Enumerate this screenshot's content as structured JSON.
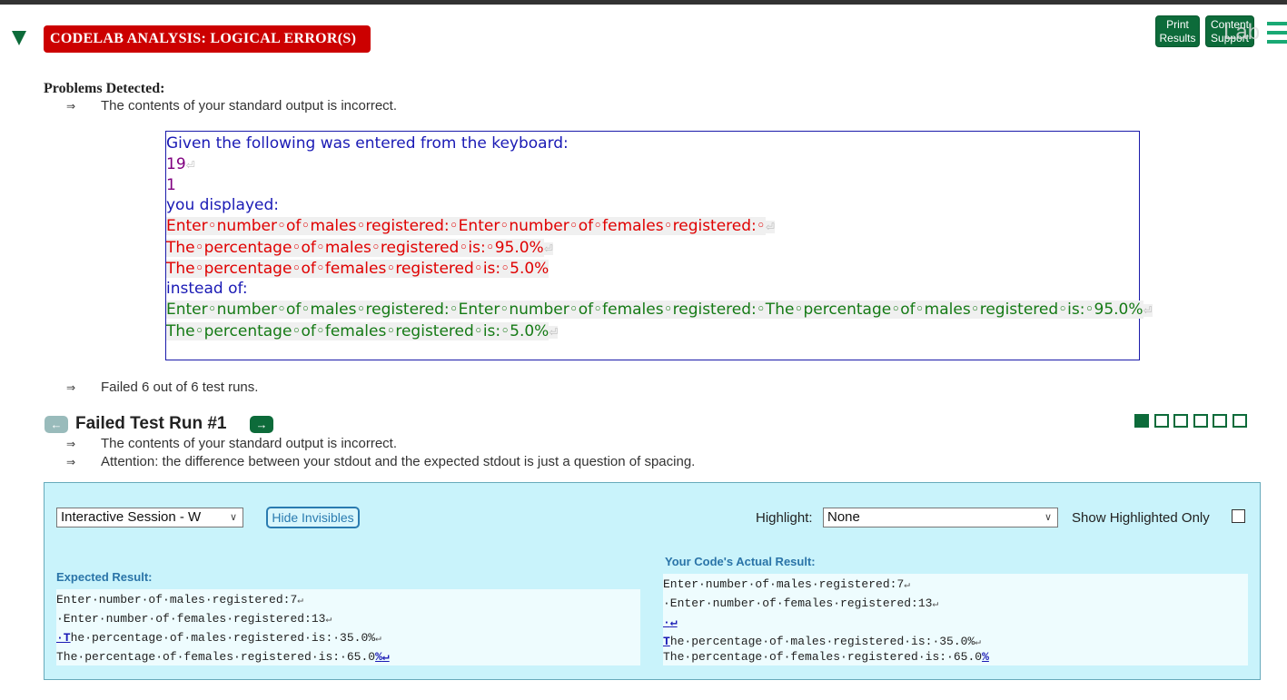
{
  "banner": {
    "title": "CODELAB ANALYSIS: LOGICAL ERROR(S)"
  },
  "toolbar": {
    "print_line1": "Print",
    "print_line2": "Results",
    "support_line1": "Content",
    "support_line2": "Support",
    "lab_mark": "Lab"
  },
  "problems": {
    "title": "Problems Detected:",
    "arrow": "⇒",
    "msg1": "The contents of your standard output is incorrect.",
    "msg2": "Failed 6 out of 6 test runs."
  },
  "codebox": {
    "given": "Given the following was entered from the keyboard:",
    "input1": "19",
    "input2": "1",
    "you_displayed": "you displayed:",
    "disp1": "Enter◦number◦of◦males◦registered:◦Enter◦number◦of◦females◦registered:◦",
    "disp2": "The◦percentage◦of◦males◦registered◦is:◦95.0%",
    "disp3": "The◦percentage◦of◦females◦registered◦is:◦5.0%",
    "instead": "instead of:",
    "exp1": "Enter◦number◦of◦males◦registered:◦Enter◦number◦of◦females◦registered:◦The◦percentage◦of◦males◦registered◦is:◦95.0%",
    "exp2": "The◦percentage◦of◦females◦registered◦is:◦5.0%",
    "return_glyph": "⏎"
  },
  "failed_run": {
    "title": "Failed Test Run #1",
    "prev": "←",
    "next": "→",
    "msg1": "The contents of your standard output is incorrect.",
    "msg2": "Attention: the difference between your stdout and the expected stdout is just a question of spacing."
  },
  "panel": {
    "session_select": "Interactive Session - W",
    "hide_invisibles": "Hide Invisibles",
    "highlight_label": "Highlight:",
    "highlight_value": "None",
    "show_highlighted": "Show Highlighted Only",
    "expected_head": "Expected Result:",
    "actual_head": "Your Code's Actual Result:",
    "dot": "·",
    "ret": "↵",
    "expected": {
      "l1": "Enter·number·of·males·registered:7",
      "l2": "·Enter·number·of·females·registered:13",
      "l3a": "·T",
      "l3b": "he·percentage·of·males·registered·is:·35.0%",
      "l4a": "The·percentage·of·females·registered·is:·65.0",
      "l4b": "%"
    },
    "actual": {
      "l1": "Enter·number·of·males·registered:7",
      "l2": "·Enter·number·of·females·registered:13",
      "l3": "·",
      "l4a": "T",
      "l4b": "he·percentage·of·males·registered·is:·35.0%",
      "l5a": "The·percentage·of·females·registered·is:·65.0",
      "l5b": "%"
    }
  },
  "colors": {
    "accent_green": "#0d6b3a",
    "banner_red": "#cc0000",
    "panel_bg": "#c9f3fb"
  }
}
